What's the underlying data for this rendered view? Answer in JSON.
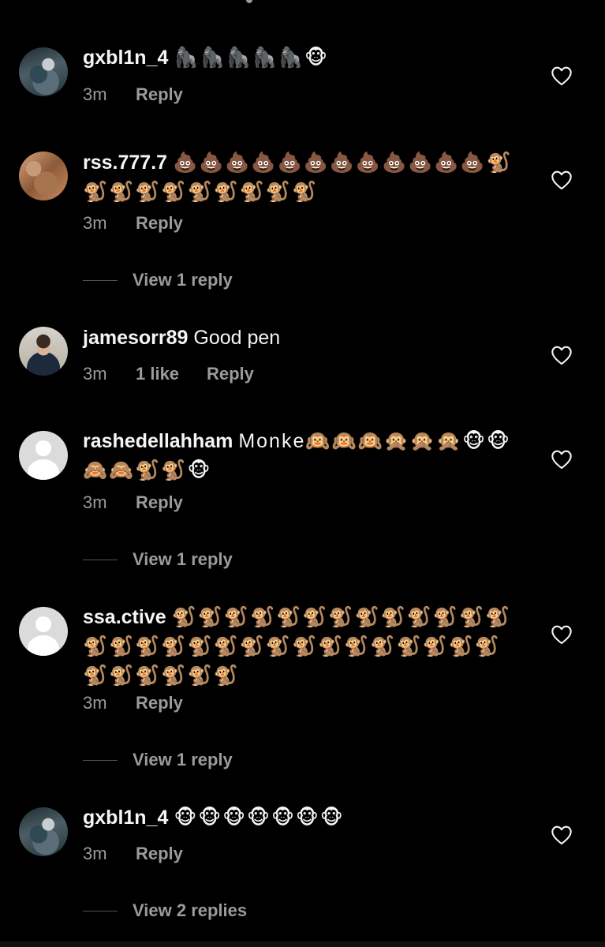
{
  "comments": [
    {
      "username": "gxbl1n_4",
      "text": "🦍🦍🦍🦍🦍🐵",
      "time": "3m",
      "likes": "",
      "reply_label": "Reply",
      "view_replies": ""
    },
    {
      "username": "rss.777.7",
      "text": "💩💩💩💩💩💩💩💩💩💩💩💩🐒🐒🐒🐒🐒🐒🐒🐒🐒🐒",
      "time": "3m",
      "likes": "",
      "reply_label": "Reply",
      "view_replies": "View 1 reply"
    },
    {
      "username": "jamesorr89",
      "text": "Good pen",
      "time": "3m",
      "likes": "1 like",
      "reply_label": "Reply",
      "view_replies": ""
    },
    {
      "username": "rashedellahham",
      "text": "Monke🙉🙉🙉🙊🙊🙊🐵🐵🙈🙈🐒🐒🐵",
      "time": "3m",
      "likes": "",
      "reply_label": "Reply",
      "view_replies": "View 1 reply"
    },
    {
      "username": "ssa.ctive",
      "text": "🐒🐒🐒🐒🐒🐒🐒🐒🐒🐒🐒🐒🐒🐒🐒🐒🐒🐒🐒🐒🐒🐒🐒🐒🐒🐒🐒🐒🐒🐒🐒🐒🐒🐒🐒",
      "time": "3m",
      "likes": "",
      "reply_label": "Reply",
      "view_replies": "View 1 reply"
    },
    {
      "username": "gxbl1n_4",
      "text": "🐵🐵🐵🐵🐵🐵🐵",
      "time": "3m",
      "likes": "",
      "reply_label": "Reply",
      "view_replies": "View 2 replies"
    }
  ],
  "icons": {
    "like": "heart-outline-icon",
    "default_avatar": "default-user-icon"
  },
  "colors": {
    "background": "#000000",
    "text": "#f5f5f5",
    "muted": "#9b9b9b"
  }
}
